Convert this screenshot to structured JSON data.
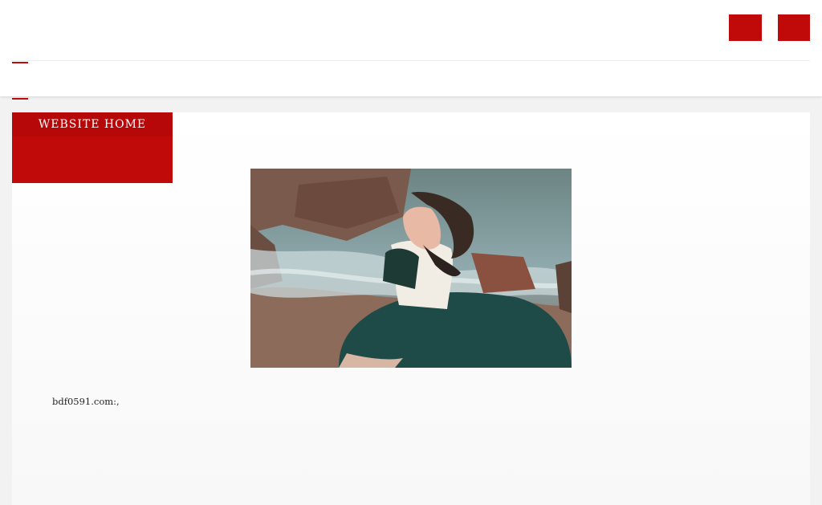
{
  "header": {
    "site_title": "",
    "buttons": [
      "",
      ""
    ]
  },
  "nav": {
    "items": [
      "",
      "",
      "",
      "",
      "",
      "",
      "",
      ""
    ]
  },
  "home_box": {
    "en": "WEBSITE HOME",
    "cn": ""
  },
  "article": {
    "paragraphs": [
      "bdf0591.com:,",
      "",
      ""
    ]
  },
  "colors": {
    "brand_red": "#c00a0a",
    "page_bg": "#f2f2f2"
  }
}
